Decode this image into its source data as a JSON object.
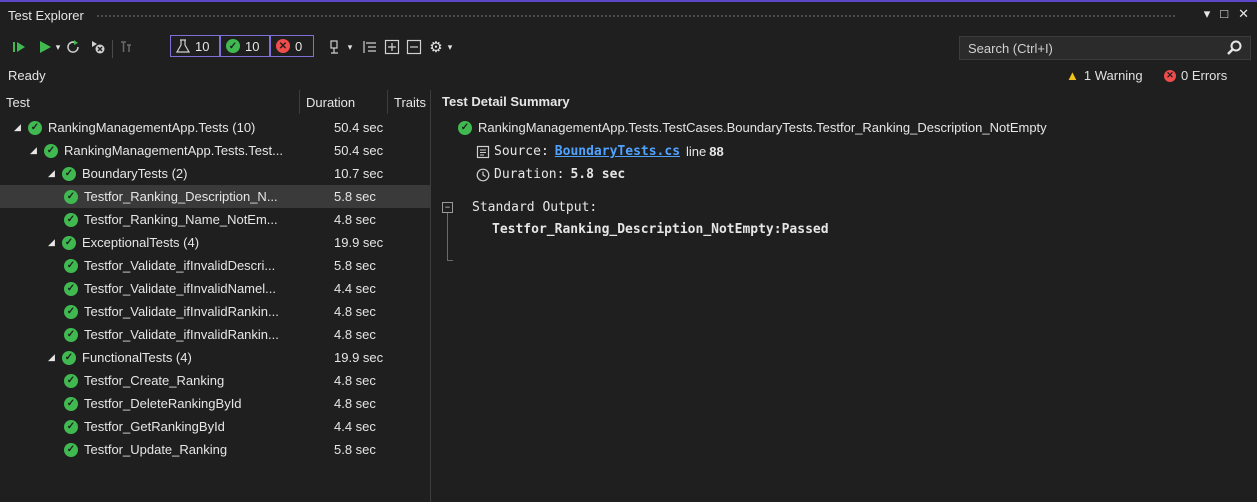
{
  "window": {
    "title": "Test Explorer",
    "controls": [
      "▾",
      "□",
      "✕"
    ]
  },
  "toolbar": {
    "counters": {
      "total": "10",
      "passed": "10",
      "failed": "0"
    },
    "search_placeholder": "Search (Ctrl+I)"
  },
  "status": {
    "ready": "Ready",
    "warnings": "1 Warning",
    "errors": "0 Errors"
  },
  "columns": {
    "test": "Test",
    "duration": "Duration",
    "traits": "Traits"
  },
  "tree": [
    {
      "name": "RankingManagementApp.Tests (10)",
      "duration": "50.4 sec",
      "level": 0,
      "expanded": true
    },
    {
      "name": "RankingManagementApp.Tests.Test...",
      "duration": "50.4 sec",
      "level": 1,
      "expanded": true
    },
    {
      "name": "BoundaryTests (2)",
      "duration": "10.7 sec",
      "level": 2,
      "expanded": true
    },
    {
      "name": "Testfor_Ranking_Description_N...",
      "duration": "5.8 sec",
      "level": 3,
      "selected": true
    },
    {
      "name": "Testfor_Ranking_Name_NotEm...",
      "duration": "4.8 sec",
      "level": 3
    },
    {
      "name": "ExceptionalTests (4)",
      "duration": "19.9 sec",
      "level": 2,
      "expanded": true
    },
    {
      "name": "Testfor_Validate_ifInvalidDescri...",
      "duration": "5.8 sec",
      "level": 3
    },
    {
      "name": "Testfor_Validate_ifInvalidNamel...",
      "duration": "4.4 sec",
      "level": 3
    },
    {
      "name": "Testfor_Validate_ifInvalidRankin...",
      "duration": "4.8 sec",
      "level": 3
    },
    {
      "name": "Testfor_Validate_ifInvalidRankin...",
      "duration": "4.8 sec",
      "level": 3
    },
    {
      "name": "FunctionalTests (4)",
      "duration": "19.9 sec",
      "level": 2,
      "expanded": true
    },
    {
      "name": "Testfor_Create_Ranking",
      "duration": "4.8 sec",
      "level": 3
    },
    {
      "name": "Testfor_DeleteRankingById",
      "duration": "4.8 sec",
      "level": 3
    },
    {
      "name": "Testfor_GetRankingById",
      "duration": "4.4 sec",
      "level": 3
    },
    {
      "name": "Testfor_Update_Ranking",
      "duration": "5.8 sec",
      "level": 3
    }
  ],
  "detail": {
    "title": "Test Detail Summary",
    "full_name": "RankingManagementApp.Tests.TestCases.BoundaryTests.Testfor_Ranking_Description_NotEmpty",
    "source_label": "Source:",
    "source_file": "BoundaryTests.cs",
    "source_line_label": "line",
    "source_line": "88",
    "duration_label": "Duration:",
    "duration_value": "5.8 sec",
    "output_label": "Standard Output:",
    "output_text": "Testfor_Ranking_Description_NotEmpty:Passed"
  }
}
